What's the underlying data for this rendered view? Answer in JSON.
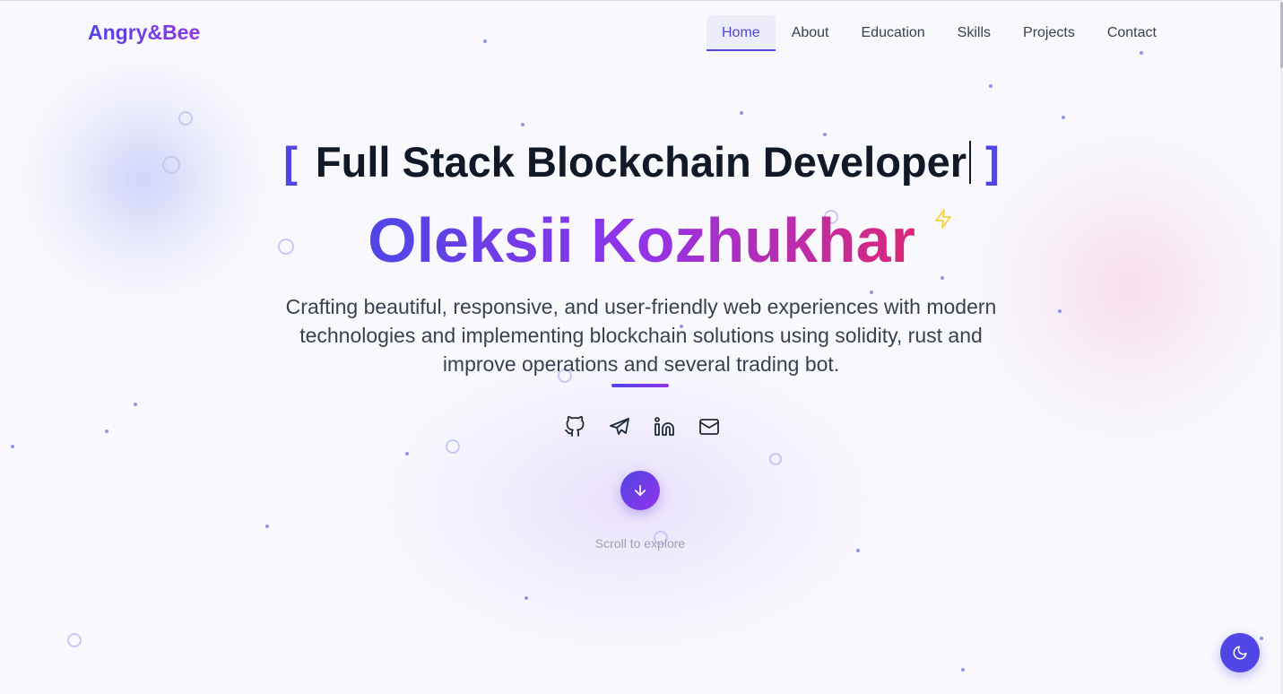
{
  "brand": {
    "logo": "Angry&Bee"
  },
  "nav": {
    "items": [
      {
        "label": "Home",
        "active": true
      },
      {
        "label": "About"
      },
      {
        "label": "Education"
      },
      {
        "label": "Skills"
      },
      {
        "label": "Projects"
      },
      {
        "label": "Contact"
      }
    ]
  },
  "hero": {
    "bracket_open": "[",
    "headline": "Full Stack Blockchain Developer",
    "bracket_close": "]",
    "name": "Oleksii Kozhukhar",
    "tagline": "Crafting beautiful, responsive, and user-friendly web experiences with modern technologies and implementing blockchain solutions using solidity, rust and improve operations and several trading bot.",
    "scroll_text": "Scroll to explore"
  },
  "socials": [
    {
      "icon": "github-icon"
    },
    {
      "icon": "telegram-icon"
    },
    {
      "icon": "linkedin-icon"
    },
    {
      "icon": "mail-icon"
    }
  ],
  "colors": {
    "accent": "#4f46e5",
    "accent_purple": "#9333ea",
    "accent_pink": "#db2777",
    "text_dark": "#111827",
    "text_body": "#374151",
    "muted": "#9ca3af",
    "bolt": "#fcd34d"
  },
  "icons": {
    "scroll": "arrow-down-icon",
    "theme": "moon-icon",
    "decor": "bolt-icon"
  }
}
